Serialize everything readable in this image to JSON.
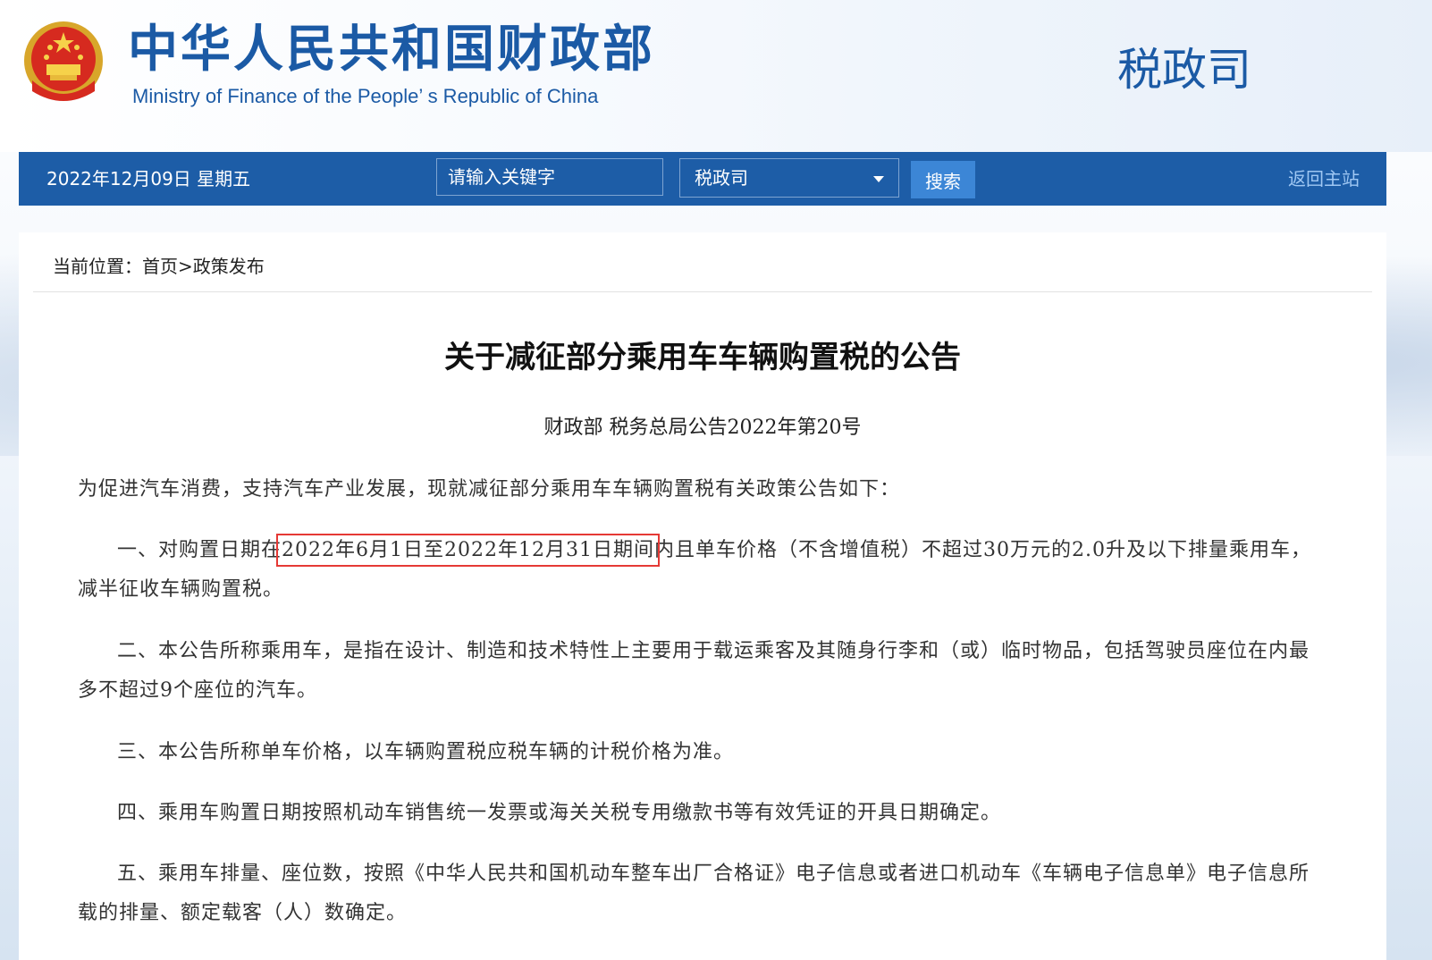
{
  "header": {
    "title_cn": "中华人民共和国财政部",
    "title_en": "Ministry of Finance of the People’ s Republic of China",
    "dept": "税政司",
    "emblem_icon": "national-emblem-icon"
  },
  "nav": {
    "date": "2022年12月09日  星期五",
    "search_placeholder": "请输入关键字",
    "select_value": "税政司",
    "search_button": "搜索",
    "home_link": "返回主站"
  },
  "breadcrumb": "当前位置：首页>政策发布",
  "article": {
    "title": "关于减征部分乘用车车辆购置税的公告",
    "subtitle": "财政部  税务总局公告2022年第20号",
    "intro": "为促进汽车消费，支持汽车产业发展，现就减征部分乘用车车辆购置税有关政策公告如下：",
    "p1_before": "一、对购置日期在",
    "p1_highlight": "2022年6月1日至2022年12月31日期间",
    "p1_after": "内且单车价格（不含增值税）不超过30万元的2.0升及以下排量乘用车，减半征收车辆购置税。",
    "p2": "二、本公告所称乘用车，是指在设计、制造和技术特性上主要用于载运乘客及其随身行李和（或）临时物品，包括驾驶员座位在内最多不超过9个座位的汽车。",
    "p3": "三、本公告所称单车价格，以车辆购置税应税车辆的计税价格为准。",
    "p4": "四、乘用车购置日期按照机动车销售统一发票或海关关税专用缴款书等有效凭证的开具日期确定。",
    "p5": "五、乘用车排量、座位数，按照《中华人民共和国机动车整车出厂合格证》电子信息或者进口机动车《车辆电子信息单》电子信息所载的排量、额定载客（人）数确定。"
  },
  "colors": {
    "brand_blue": "#1b5aa5",
    "nav_bg": "#1d5da7",
    "highlight_red": "#e53935"
  }
}
